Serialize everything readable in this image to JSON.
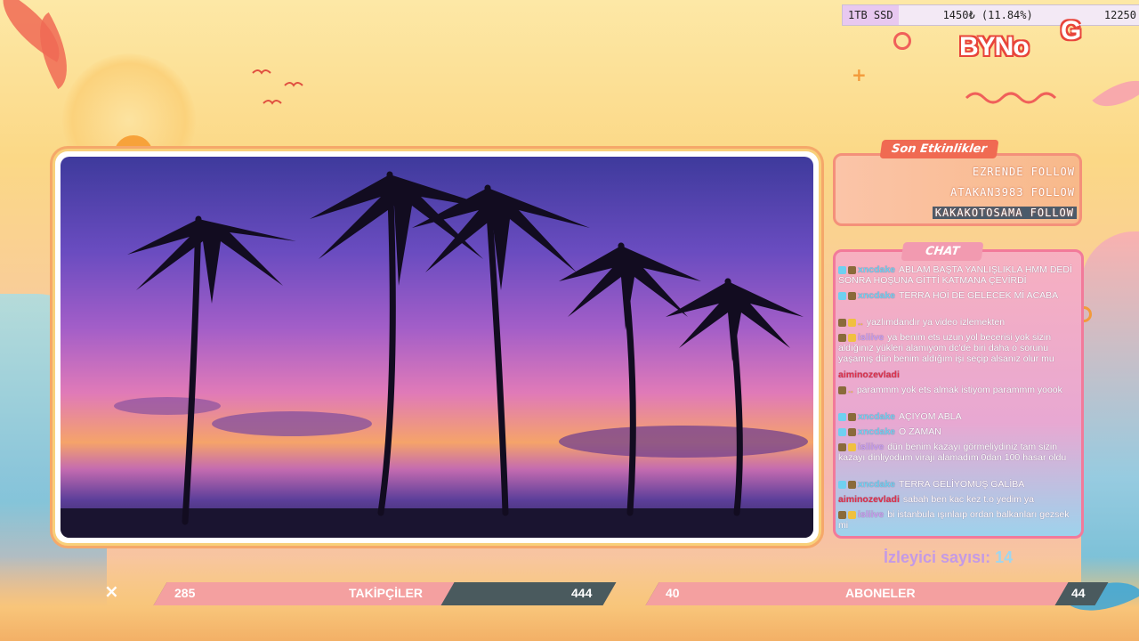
{
  "top_bar": {
    "storage_label": "1TB SSD",
    "price_text": "1450₺ (11.84%)",
    "right_value": "12250"
  },
  "logo": {
    "brand_text": "BYNo",
    "letter": "G"
  },
  "events_panel": {
    "title": "Son Etkinlikler",
    "items": [
      {
        "text": "EZRENDE FOLLOW"
      },
      {
        "text": "ATAKAN3983 FOLLOW"
      },
      {
        "text": "KAKAKOTOSAMA FOLLOW"
      }
    ]
  },
  "chat_panel": {
    "title": "CHAT",
    "messages": [
      {
        "user": "xncdake",
        "text": "ABLAM BAŞTA YANLIŞLIKLA HMM DEDİ SONRA HOŞUNA GİTTİ KATMANA ÇEVİRDİ",
        "user_color": "#6fd0f0"
      },
      {
        "user": "xncdake",
        "text": "TERRA HOİ DE GELECEK Mİ ACABA",
        "user_color": "#6fd0f0"
      },
      {
        "user": "..",
        "text": "yazlımdandır ya video izlemekten",
        "user_color": "#f0c040"
      },
      {
        "user": "isliive",
        "text": "ya benim ets uzun yol becerisi yok sizin aldığınız yükleri alamıyom dc'de biri daha o sorunu yaşamış dün benim aldığım işi seçip alsanız olur mu",
        "user_color": "#c7a0f0"
      },
      {
        "user": "aiminozevladi",
        "text": "",
        "user_color": "#e0304a"
      },
      {
        "user": "..",
        "text": "parammm yok ets almak istiyom parammm yoook",
        "user_color": "#f0c040"
      },
      {
        "user": "xncdake",
        "text": "AÇIYOM ABLA",
        "user_color": "#6fd0f0"
      },
      {
        "user": "xncdake",
        "text": "O ZAMAN",
        "user_color": "#6fd0f0"
      },
      {
        "user": "isliive",
        "text": "dün benim kazayı görmeliydiniz tam sizin kazayı dinliyodum virajı alamadım 0dan 100 hasar oldu",
        "user_color": "#c7a0f0"
      },
      {
        "user": "xncdake",
        "text": "TERRA GELİYOMUŞ GALİBA",
        "user_color": "#6fd0f0"
      },
      {
        "user": "aiminozevladi",
        "text": "sabah ben kac kez t.o yedim ya",
        "user_color": "#e0304a"
      },
      {
        "user": "isliive",
        "text": "bi istanbula ışınlaıp ordan balkanları gezsek mi",
        "user_color": "#c7a0f0"
      }
    ]
  },
  "viewers": {
    "label": "İzleyici sayısı:",
    "count": "14"
  },
  "followers_bar": {
    "current": "285",
    "label": "TAKİPÇİLER",
    "goal": "444",
    "progress": 0.64
  },
  "subscribers_bar": {
    "current": "40",
    "label": "ABONELER",
    "goal": "44",
    "progress": 0.91
  },
  "colors": {
    "accent": "#f06a52",
    "chat_border": "#f27a9a",
    "bar_fill": "#f4a0a0",
    "bar_bg": "#4a5a5e"
  }
}
